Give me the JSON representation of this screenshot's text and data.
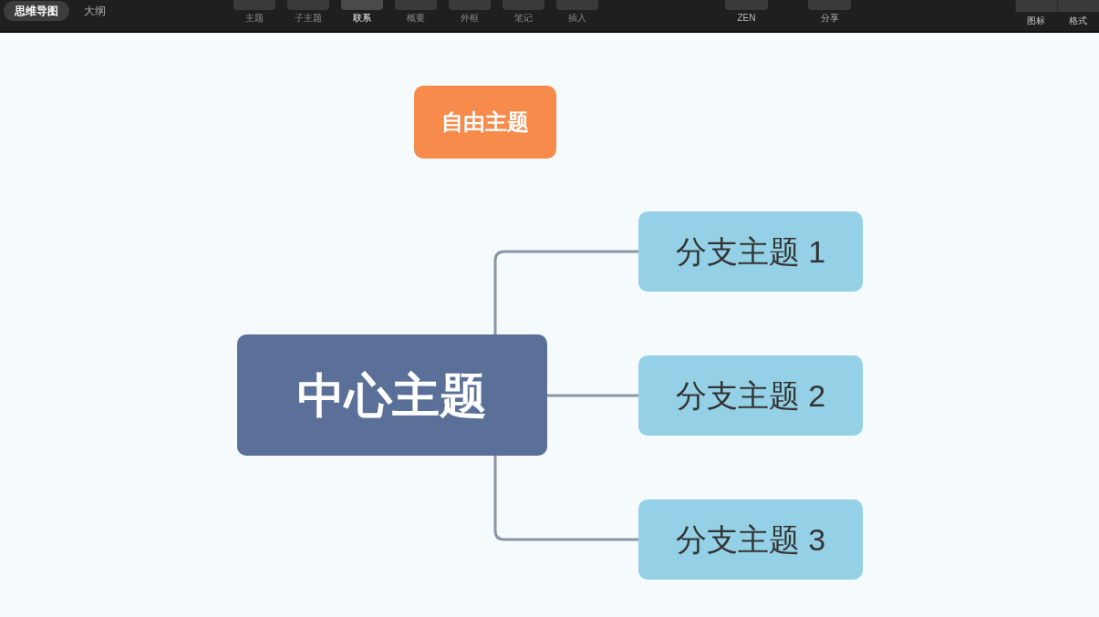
{
  "view_tabs": [
    {
      "label": "思维导图",
      "selected": true
    },
    {
      "label": "大纲",
      "selected": false
    }
  ],
  "toolbar": [
    {
      "label": "主题",
      "selected": false
    },
    {
      "label": "子主题",
      "selected": false
    },
    {
      "label": "联系",
      "selected": true
    },
    {
      "label": "概要",
      "selected": false
    },
    {
      "label": "外框",
      "selected": false
    },
    {
      "label": "笔记",
      "selected": false
    },
    {
      "label": "插入",
      "selected": false
    }
  ],
  "view_tools": [
    {
      "label": "ZEN"
    },
    {
      "label": "分享"
    }
  ],
  "panel_tools": [
    {
      "label": "图标"
    },
    {
      "label": "格式"
    }
  ],
  "mind_map": {
    "floating_topic": {
      "label": "自由主题"
    },
    "central_topic": {
      "label": "中心主题"
    },
    "branches": [
      {
        "label": "分支主题 1"
      },
      {
        "label": "分支主题 2"
      },
      {
        "label": "分支主题 3"
      }
    ]
  }
}
